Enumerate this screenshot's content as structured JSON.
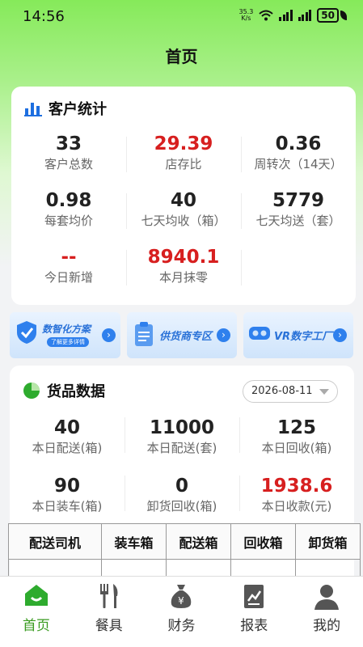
{
  "status_bar": {
    "time": "14:56",
    "net_speed": "35.3",
    "net_unit": "K/s",
    "battery": "50"
  },
  "page_title": "首页",
  "customer_stats": {
    "title": "客户统计",
    "items": [
      {
        "value": "33",
        "label": "客户总数",
        "red": false
      },
      {
        "value": "29.39",
        "label": "店存比",
        "red": true
      },
      {
        "value": "0.36",
        "label": "周转次（14天）",
        "red": false
      },
      {
        "value": "0.98",
        "label": "每套均价",
        "red": false
      },
      {
        "value": "40",
        "label": "七天均收（箱）",
        "red": false
      },
      {
        "value": "5779",
        "label": "七天均送（套）",
        "red": false
      },
      {
        "value": "--",
        "label": "今日新增",
        "red": true
      },
      {
        "value": "8940.1",
        "label": "本月抹零",
        "red": true
      }
    ]
  },
  "banners": [
    {
      "title": "数智化方案",
      "sub": "了解更多详情"
    },
    {
      "title": "供货商专区"
    },
    {
      "title": "VR数字工厂"
    }
  ],
  "goods_data": {
    "title": "货品数据",
    "date": "2026-08-11",
    "items": [
      {
        "value": "40",
        "label": "本日配送(箱)",
        "red": false
      },
      {
        "value": "11000",
        "label": "本日配送(套)",
        "red": false
      },
      {
        "value": "125",
        "label": "本日回收(箱)",
        "red": false
      },
      {
        "value": "90",
        "label": "本日装车(箱)",
        "red": false
      },
      {
        "value": "0",
        "label": "卸货回收(箱)",
        "red": false
      },
      {
        "value": "1938.6",
        "label": "本日收款(元)",
        "red": true
      }
    ],
    "table_headers": [
      "配送司机",
      "装车箱",
      "配送箱",
      "回收箱",
      "卸货箱"
    ]
  },
  "tabbar": [
    {
      "label": "首页",
      "icon": "home-icon",
      "active": true
    },
    {
      "label": "餐具",
      "icon": "tableware-icon",
      "active": false
    },
    {
      "label": "财务",
      "icon": "money-bag-icon",
      "active": false
    },
    {
      "label": "报表",
      "icon": "report-icon",
      "active": false
    },
    {
      "label": "我的",
      "icon": "user-icon",
      "active": false
    }
  ],
  "colors": {
    "accent": "#3a9b20",
    "highlight": "#d71f1f",
    "bg_green": "#86ea5a"
  }
}
